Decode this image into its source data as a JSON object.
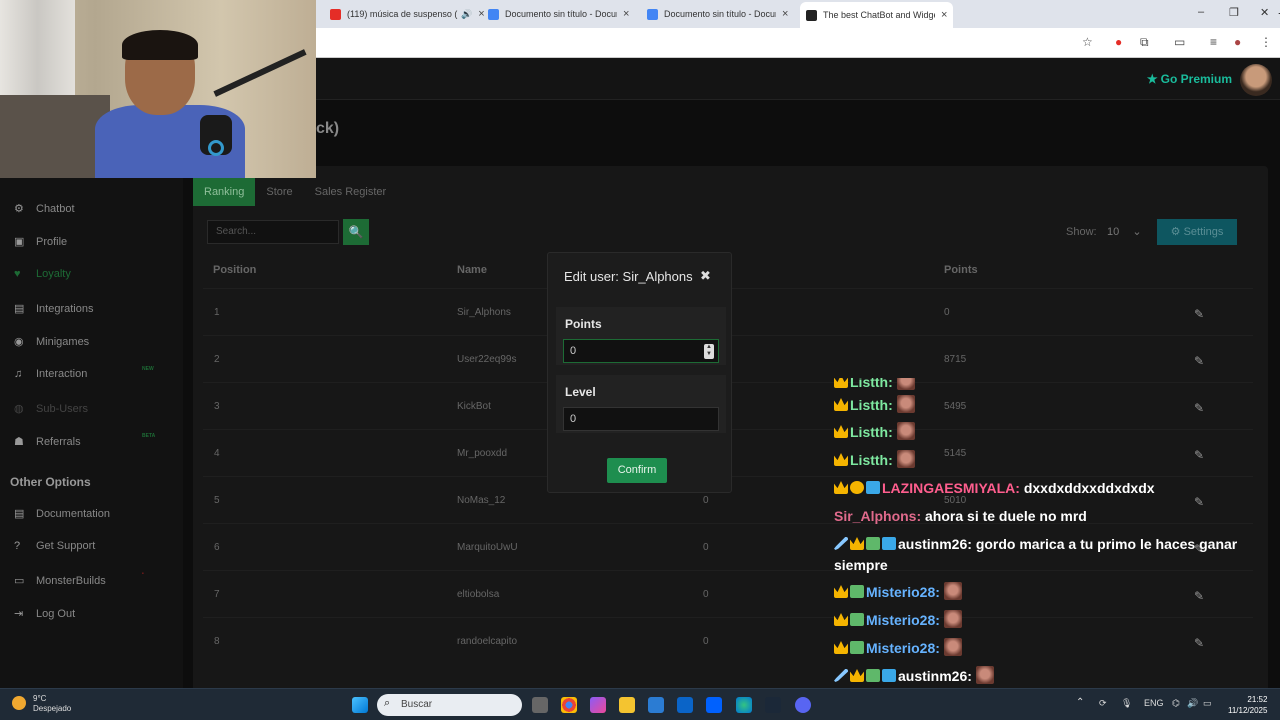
{
  "browser": {
    "tabs": [
      {
        "title": "(119) música de suspenso (",
        "icon_color": "#e52d27",
        "active": false
      },
      {
        "title": "Documento sin título - Docum",
        "icon_color": "#4285f4",
        "active": false
      },
      {
        "title": "Documento sin título - Docum",
        "icon_color": "#4285f4",
        "active": false
      },
      {
        "title": "The best ChatBot and Widgets",
        "icon_color": "#222222",
        "active": true
      }
    ],
    "new_tab_label": "+",
    "close_label": "×",
    "minimize_label": "–",
    "restore_label": "❐",
    "window_close_label": "✕"
  },
  "header": {
    "premium_label": "Go Premium",
    "premium_star": "★"
  },
  "page": {
    "title_fragment": "ck)",
    "tabs": [
      "Ranking",
      "Store",
      "Sales Register"
    ],
    "search_placeholder": "Search...",
    "search_icon": "🔍",
    "show_label": "Show:",
    "show_value": "10",
    "settings_label": "Settings",
    "settings_icon": "⚙",
    "columns": {
      "position": "Position",
      "name": "Name",
      "points": "Points"
    },
    "rows": [
      {
        "position": "1",
        "name": "Sir_Alphons",
        "level": "",
        "points": "0"
      },
      {
        "position": "2",
        "name": "User22eq99s",
        "level": "",
        "points": "8715"
      },
      {
        "position": "3",
        "name": "KickBot",
        "level": "",
        "points": "5495"
      },
      {
        "position": "4",
        "name": "Mr_pooxdd",
        "level": "",
        "points": "5145"
      },
      {
        "position": "5",
        "name": "NoMas_12",
        "level": "0",
        "points": "5010"
      },
      {
        "position": "6",
        "name": "MarquitoUwU",
        "level": "0",
        "points": ""
      },
      {
        "position": "7",
        "name": "eltiobolsa",
        "level": "0",
        "points": ""
      },
      {
        "position": "8",
        "name": "randoelcapito",
        "level": "0",
        "points": ""
      }
    ],
    "edit_icon": "✎"
  },
  "sidebar": {
    "items": [
      {
        "label": "Chatbot",
        "icon": "⚙",
        "state": "normal"
      },
      {
        "label": "Profile",
        "icon": "▣",
        "state": "normal"
      },
      {
        "label": "Loyalty",
        "icon": "♥",
        "state": "active"
      },
      {
        "label": "Integrations",
        "icon": "▤",
        "state": "normal"
      },
      {
        "label": "Minigames",
        "icon": "◉",
        "state": "normal"
      },
      {
        "label": "Interaction",
        "icon": "♫",
        "state": "normal",
        "badge": "NEW"
      },
      {
        "label": "Sub-Users",
        "icon": "◍",
        "state": "dim"
      },
      {
        "label": "Referrals",
        "icon": "☗",
        "state": "normal",
        "badge": "BETA"
      }
    ],
    "other_heading": "Other Options",
    "other_items": [
      {
        "label": "Documentation",
        "icon": "▤"
      },
      {
        "label": "Get Support",
        "icon": "?"
      },
      {
        "label": "MonsterBuilds",
        "icon": "▭",
        "badge": "•"
      },
      {
        "label": "Log Out",
        "icon": "⇥"
      }
    ]
  },
  "modal": {
    "title": "Edit user: Sir_Alphons",
    "close_icon": "✖",
    "points_label": "Points",
    "points_value": "0",
    "level_label": "Level",
    "level_value": "0",
    "confirm_label": "Confirm"
  },
  "chat": [
    {
      "badges": [
        "crown"
      ],
      "user": "Listth:",
      "color": "u-green",
      "message": "",
      "emote": true
    },
    {
      "badges": [
        "crown"
      ],
      "user": "Listth:",
      "color": "u-green",
      "message": "",
      "emote": true
    },
    {
      "badges": [
        "crown"
      ],
      "user": "Listth:",
      "color": "u-green",
      "message": "",
      "emote": true
    },
    {
      "badges": [
        "crown",
        "coin",
        "cube"
      ],
      "user": "LAZINGAESMIYALA:",
      "color": "u-pink",
      "message": "dxxdxddxxddxdxdx",
      "emote": false
    },
    {
      "badges": [],
      "user": "Sir_Alphons:",
      "color": "u-rose",
      "message": "ahora si te duele no mrd",
      "emote": false
    },
    {
      "badges": [
        "sword",
        "crown",
        "cube",
        "cube"
      ],
      "user": "austinm26:",
      "color": "u-white",
      "message": "gordo marica a tu primo le haces ganar siempre",
      "emote": false
    },
    {
      "badges": [
        "crown",
        "cube"
      ],
      "user": "Misterio28:",
      "color": "u-blue",
      "message": "",
      "emote": true
    },
    {
      "badges": [
        "crown",
        "cube"
      ],
      "user": "Misterio28:",
      "color": "u-blue",
      "message": "",
      "emote": true
    },
    {
      "badges": [
        "crown",
        "cube"
      ],
      "user": "Misterio28:",
      "color": "u-blue",
      "message": "",
      "emote": true
    },
    {
      "badges": [
        "sword",
        "crown",
        "cube",
        "cube"
      ],
      "user": "austinm26:",
      "color": "u-white",
      "message": "",
      "emote": true
    },
    {
      "badges": [
        "sword",
        "crown",
        "cube",
        "cube"
      ],
      "user": "austinm26:",
      "color": "u-white",
      "message": "",
      "emote": true
    }
  ],
  "taskbar": {
    "temperature": "9°C",
    "weather": "Despejado",
    "search_placeholder": "Buscar",
    "language": "ENG",
    "time": "21:52",
    "date": "11/12/2025"
  }
}
